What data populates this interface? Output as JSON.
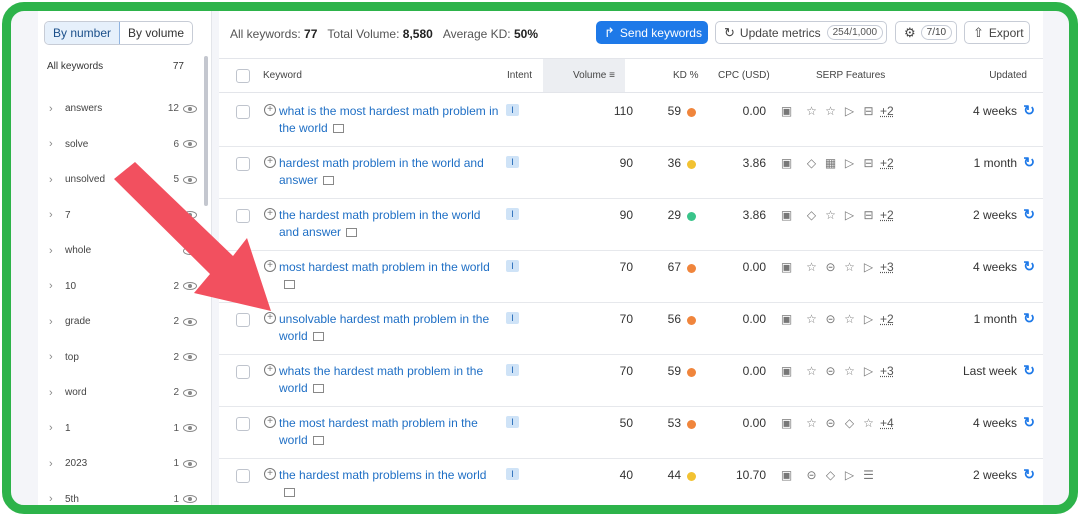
{
  "sidebar": {
    "toggle": {
      "by_number": "By number",
      "by_volume": "By volume"
    },
    "all_label": "All keywords",
    "all_count": "77",
    "items": [
      {
        "label": "answers",
        "count": "12"
      },
      {
        "label": "solve",
        "count": "6"
      },
      {
        "label": "unsolved",
        "count": "5"
      },
      {
        "label": "7",
        "count": ""
      },
      {
        "label": "whole",
        "count": ""
      },
      {
        "label": "10",
        "count": "2"
      },
      {
        "label": "grade",
        "count": "2"
      },
      {
        "label": "top",
        "count": "2"
      },
      {
        "label": "word",
        "count": "2"
      },
      {
        "label": "1",
        "count": "1"
      },
      {
        "label": "2023",
        "count": "1"
      },
      {
        "label": "5th",
        "count": "1"
      }
    ]
  },
  "summary": {
    "all_keywords_label": "All keywords:",
    "all_keywords_value": "77",
    "total_volume_label": "Total Volume:",
    "total_volume_value": "8,580",
    "avg_kd_label": "Average KD:",
    "avg_kd_value": "50%"
  },
  "toolbar": {
    "send_label": "Send keywords",
    "update_label": "Update metrics",
    "update_quota": "254/1,000",
    "settings_count": "7/10",
    "export_label": "Export"
  },
  "columns": {
    "keyword": "Keyword",
    "intent": "Intent",
    "volume": "Volume",
    "kd": "KD %",
    "cpc": "CPC (USD)",
    "serp": "SERP Features",
    "updated": "Updated"
  },
  "rows": [
    {
      "keyword": "what is the most hardest math problem in the world",
      "intent": "I",
      "volume": "110",
      "kd": "59",
      "kd_color": "#f0853c",
      "cpc": "0.00",
      "serp_more": "+2",
      "updated": "4 weeks"
    },
    {
      "keyword": "hardest math problem in the world and answer",
      "intent": "I",
      "volume": "90",
      "kd": "36",
      "kd_color": "#f2c232",
      "cpc": "3.86",
      "serp_more": "+2",
      "updated": "1 month"
    },
    {
      "keyword": "the hardest math problem in the world and answer",
      "intent": "I",
      "volume": "90",
      "kd": "29",
      "kd_color": "#39c48a",
      "cpc": "3.86",
      "serp_more": "+2",
      "updated": "2 weeks"
    },
    {
      "keyword": "most hardest math problem in the world",
      "intent": "I",
      "volume": "70",
      "kd": "67",
      "kd_color": "#f0853c",
      "cpc": "0.00",
      "serp_more": "+3",
      "updated": "4 weeks"
    },
    {
      "keyword": "unsolvable hardest math problem in the world",
      "intent": "I",
      "volume": "70",
      "kd": "56",
      "kd_color": "#f0853c",
      "cpc": "0.00",
      "serp_more": "+2",
      "updated": "1 month"
    },
    {
      "keyword": "whats the hardest math problem in the world",
      "intent": "I",
      "volume": "70",
      "kd": "59",
      "kd_color": "#f0853c",
      "cpc": "0.00",
      "serp_more": "+3",
      "updated": "Last week"
    },
    {
      "keyword": "the most hardest math problem in the world",
      "intent": "I",
      "volume": "50",
      "kd": "53",
      "kd_color": "#f0853c",
      "cpc": "0.00",
      "serp_more": "+4",
      "updated": "4 weeks"
    },
    {
      "keyword": "the hardest math problems in the world",
      "intent": "I",
      "volume": "40",
      "kd": "44",
      "kd_color": "#f2c232",
      "cpc": "10.70",
      "serp_more": "",
      "updated": "2 weeks"
    }
  ],
  "colors": {
    "frame": "#2db34a",
    "accent": "#1e79e8",
    "arrow": "#f2505f"
  }
}
